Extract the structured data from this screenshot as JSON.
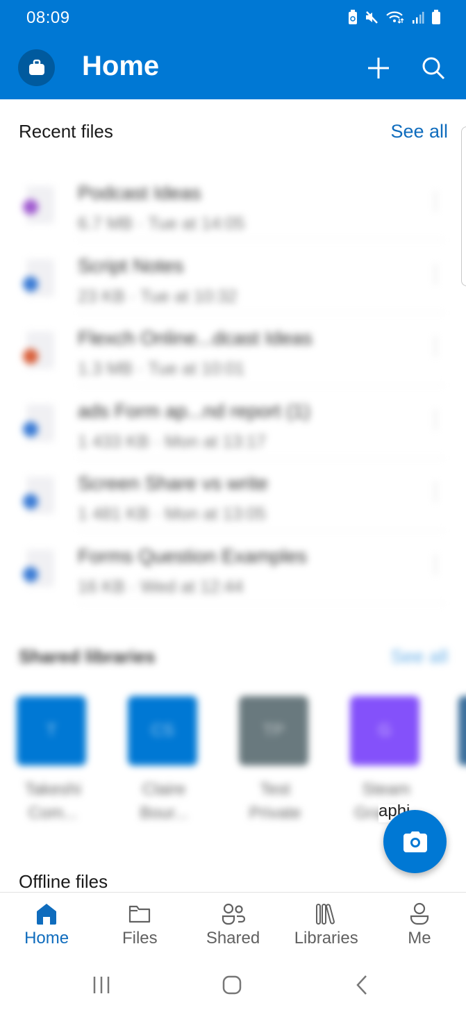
{
  "status_bar": {
    "time": "08:09",
    "icons": [
      "battery-saver-icon",
      "mute-icon",
      "wifi-icon",
      "signal-icon",
      "battery-icon"
    ]
  },
  "header": {
    "title": "Home",
    "account_icon": "briefcase-icon",
    "actions": [
      "add-icon",
      "search-icon"
    ]
  },
  "recent_files": {
    "title": "Recent files",
    "see_all": "See all",
    "items": [
      {
        "name": "Podcast Ideas",
        "meta": "6.7 MB · Tue at 14:05",
        "icon_color": "#a05ad0"
      },
      {
        "name": "Script Notes",
        "meta": "23 KB · Tue at 10:32",
        "icon_color": "#3a7bd5"
      },
      {
        "name": "Flexch Online...dcast Ideas",
        "meta": "1.3 MB · Tue at 10:01",
        "icon_color": "#d9603b"
      },
      {
        "name": "ads Form ap...nd report (1)",
        "meta": "1 433 KB · Mon at 13:17",
        "icon_color": "#3a7bd5"
      },
      {
        "name": "Screen Share vs write",
        "meta": "1 481 KB · Mon at 13:05",
        "icon_color": "#3a7bd5"
      },
      {
        "name": "Forms Question Examples",
        "meta": "16 KB · Wed at 12:44",
        "icon_color": "#3a7bd5"
      }
    ]
  },
  "shared_libraries": {
    "title": "Shared libraries",
    "see_all": "See all",
    "items": [
      {
        "initials": "T",
        "name_line1": "Takeshi",
        "name_line2": "Com...",
        "color": "#0078d4"
      },
      {
        "initials": "CS",
        "name_line1": "Claire",
        "name_line2": "Bour...",
        "color": "#0078d4"
      },
      {
        "initials": "TP",
        "name_line1": "Test",
        "name_line2": "Private",
        "color": "#69797e"
      },
      {
        "initials": "G",
        "name_line1": "Steam",
        "name_line2": "Graphi...",
        "color": "#8451fa"
      }
    ],
    "peek_text": "aphi..."
  },
  "offline_files": {
    "title": "Offline files"
  },
  "fab": {
    "icon": "camera-icon"
  },
  "bottom_nav": {
    "items": [
      {
        "label": "Home",
        "icon": "home-icon",
        "active": true
      },
      {
        "label": "Files",
        "icon": "folder-icon",
        "active": false
      },
      {
        "label": "Shared",
        "icon": "people-icon",
        "active": false
      },
      {
        "label": "Libraries",
        "icon": "library-icon",
        "active": false
      },
      {
        "label": "Me",
        "icon": "person-icon",
        "active": false
      }
    ]
  },
  "colors": {
    "brand": "#0078d4",
    "link": "#0f6cbd"
  }
}
